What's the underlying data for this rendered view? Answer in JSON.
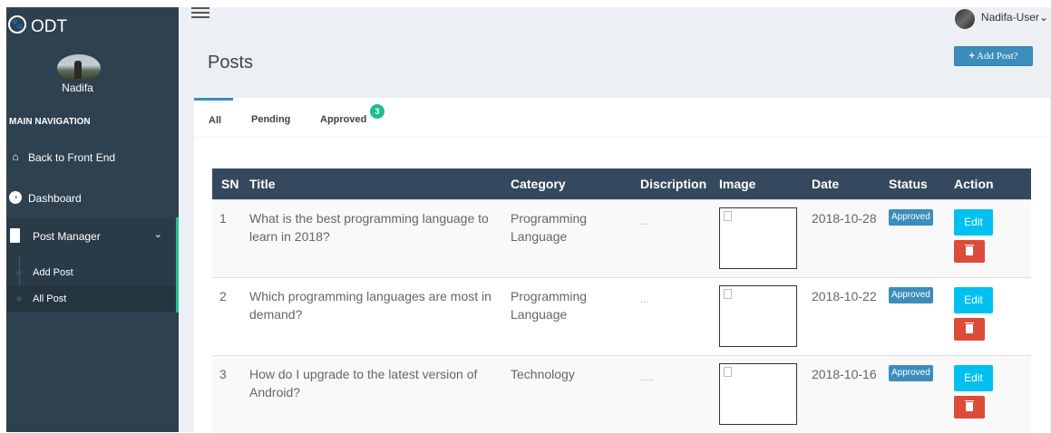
{
  "brand": {
    "name": "ODT",
    "logo_icon": "paw-icon"
  },
  "profile": {
    "name": "Nadifa"
  },
  "nav": {
    "header": "MAIN NAVIGATION",
    "items": [
      {
        "label": "Back to Front End",
        "icon": "home-icon"
      },
      {
        "label": "Dashboard",
        "icon": "dashboard-icon"
      },
      {
        "label": "Post Manager",
        "icon": "file-icon"
      }
    ],
    "sub_items": [
      {
        "label": "Add Post"
      },
      {
        "label": "All Post"
      }
    ]
  },
  "topbar": {
    "user_name": "Nadifa-User",
    "caret": "⌄"
  },
  "page": {
    "title": "Posts",
    "add_button": "Add Post?",
    "add_button_icon": "+"
  },
  "tabs": [
    {
      "label": "All"
    },
    {
      "label": "Pending"
    },
    {
      "label": "Approved",
      "badge": "3"
    }
  ],
  "table": {
    "columns": [
      "SN",
      "Title",
      "Category",
      "Discription",
      "Image",
      "Date",
      "Status",
      "Action"
    ],
    "rows": [
      {
        "sn": "1",
        "title": "What is the best programming language to learn in 2018?",
        "category": "Programming Language",
        "description": "...",
        "date": "2018-10-28",
        "status": "Approved",
        "edit": "Edit"
      },
      {
        "sn": "2",
        "title": "Which programming languages are most in demand?",
        "category": "Programming Language",
        "description": "...",
        "date": "2018-10-22",
        "status": "Approved",
        "edit": "Edit"
      },
      {
        "sn": "3",
        "title": "How do I upgrade to the latest version of Android?",
        "category": "Technology",
        "description": ".....",
        "date": "2018-10-16",
        "status": "Approved",
        "edit": "Edit"
      }
    ]
  },
  "colors": {
    "sidebar": "#2e4150",
    "accent_green": "#1fbf8f",
    "primary": "#3c8dbc",
    "info": "#00c0ef",
    "danger": "#dd4b39",
    "table_header": "#34495e"
  }
}
